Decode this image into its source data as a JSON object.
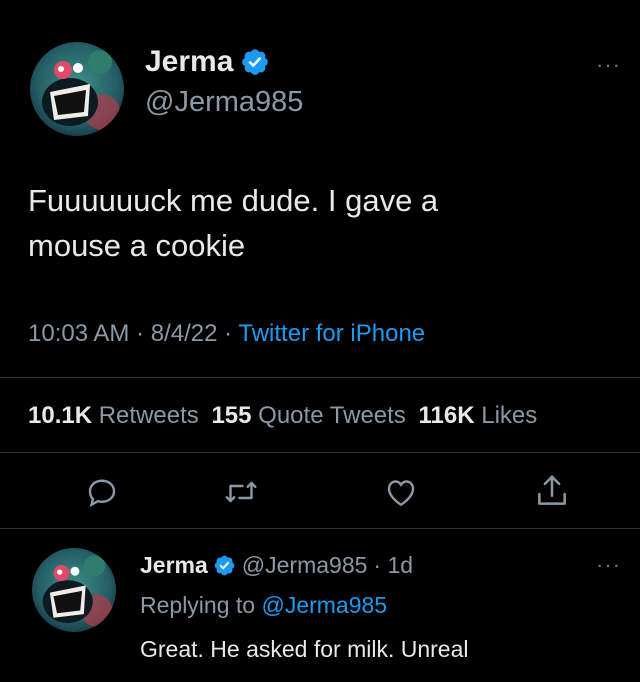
{
  "tweet": {
    "author_name": "Jerma",
    "author_handle": "@Jerma985",
    "text_line1": "Fuuuuuuck me dude. I gave a",
    "text_line2": "mouse a cookie",
    "time": "10:03 AM",
    "date": "8/4/22",
    "source": "Twitter for iPhone",
    "sep": "·",
    "more": "···",
    "stats": {
      "retweets_count": "10.1K",
      "retweets_label": "Retweets",
      "quotes_count": "155",
      "quotes_label": "Quote Tweets",
      "likes_count": "116K",
      "likes_label": "Likes"
    },
    "actions": [
      "reply-icon",
      "retweet-icon",
      "like-icon",
      "share-icon"
    ]
  },
  "reply": {
    "author_name": "Jerma",
    "author_handle": "@Jerma985",
    "age": "· 1d",
    "replying_prefix": "Replying to",
    "replying_handle": "@Jerma985",
    "text": "Great. He asked for milk. Unreal",
    "more": "···"
  },
  "colors": {
    "background": "#000000",
    "accent": "#1d9bf0",
    "muted": "#8b98a5",
    "divider": "#2f3336"
  }
}
